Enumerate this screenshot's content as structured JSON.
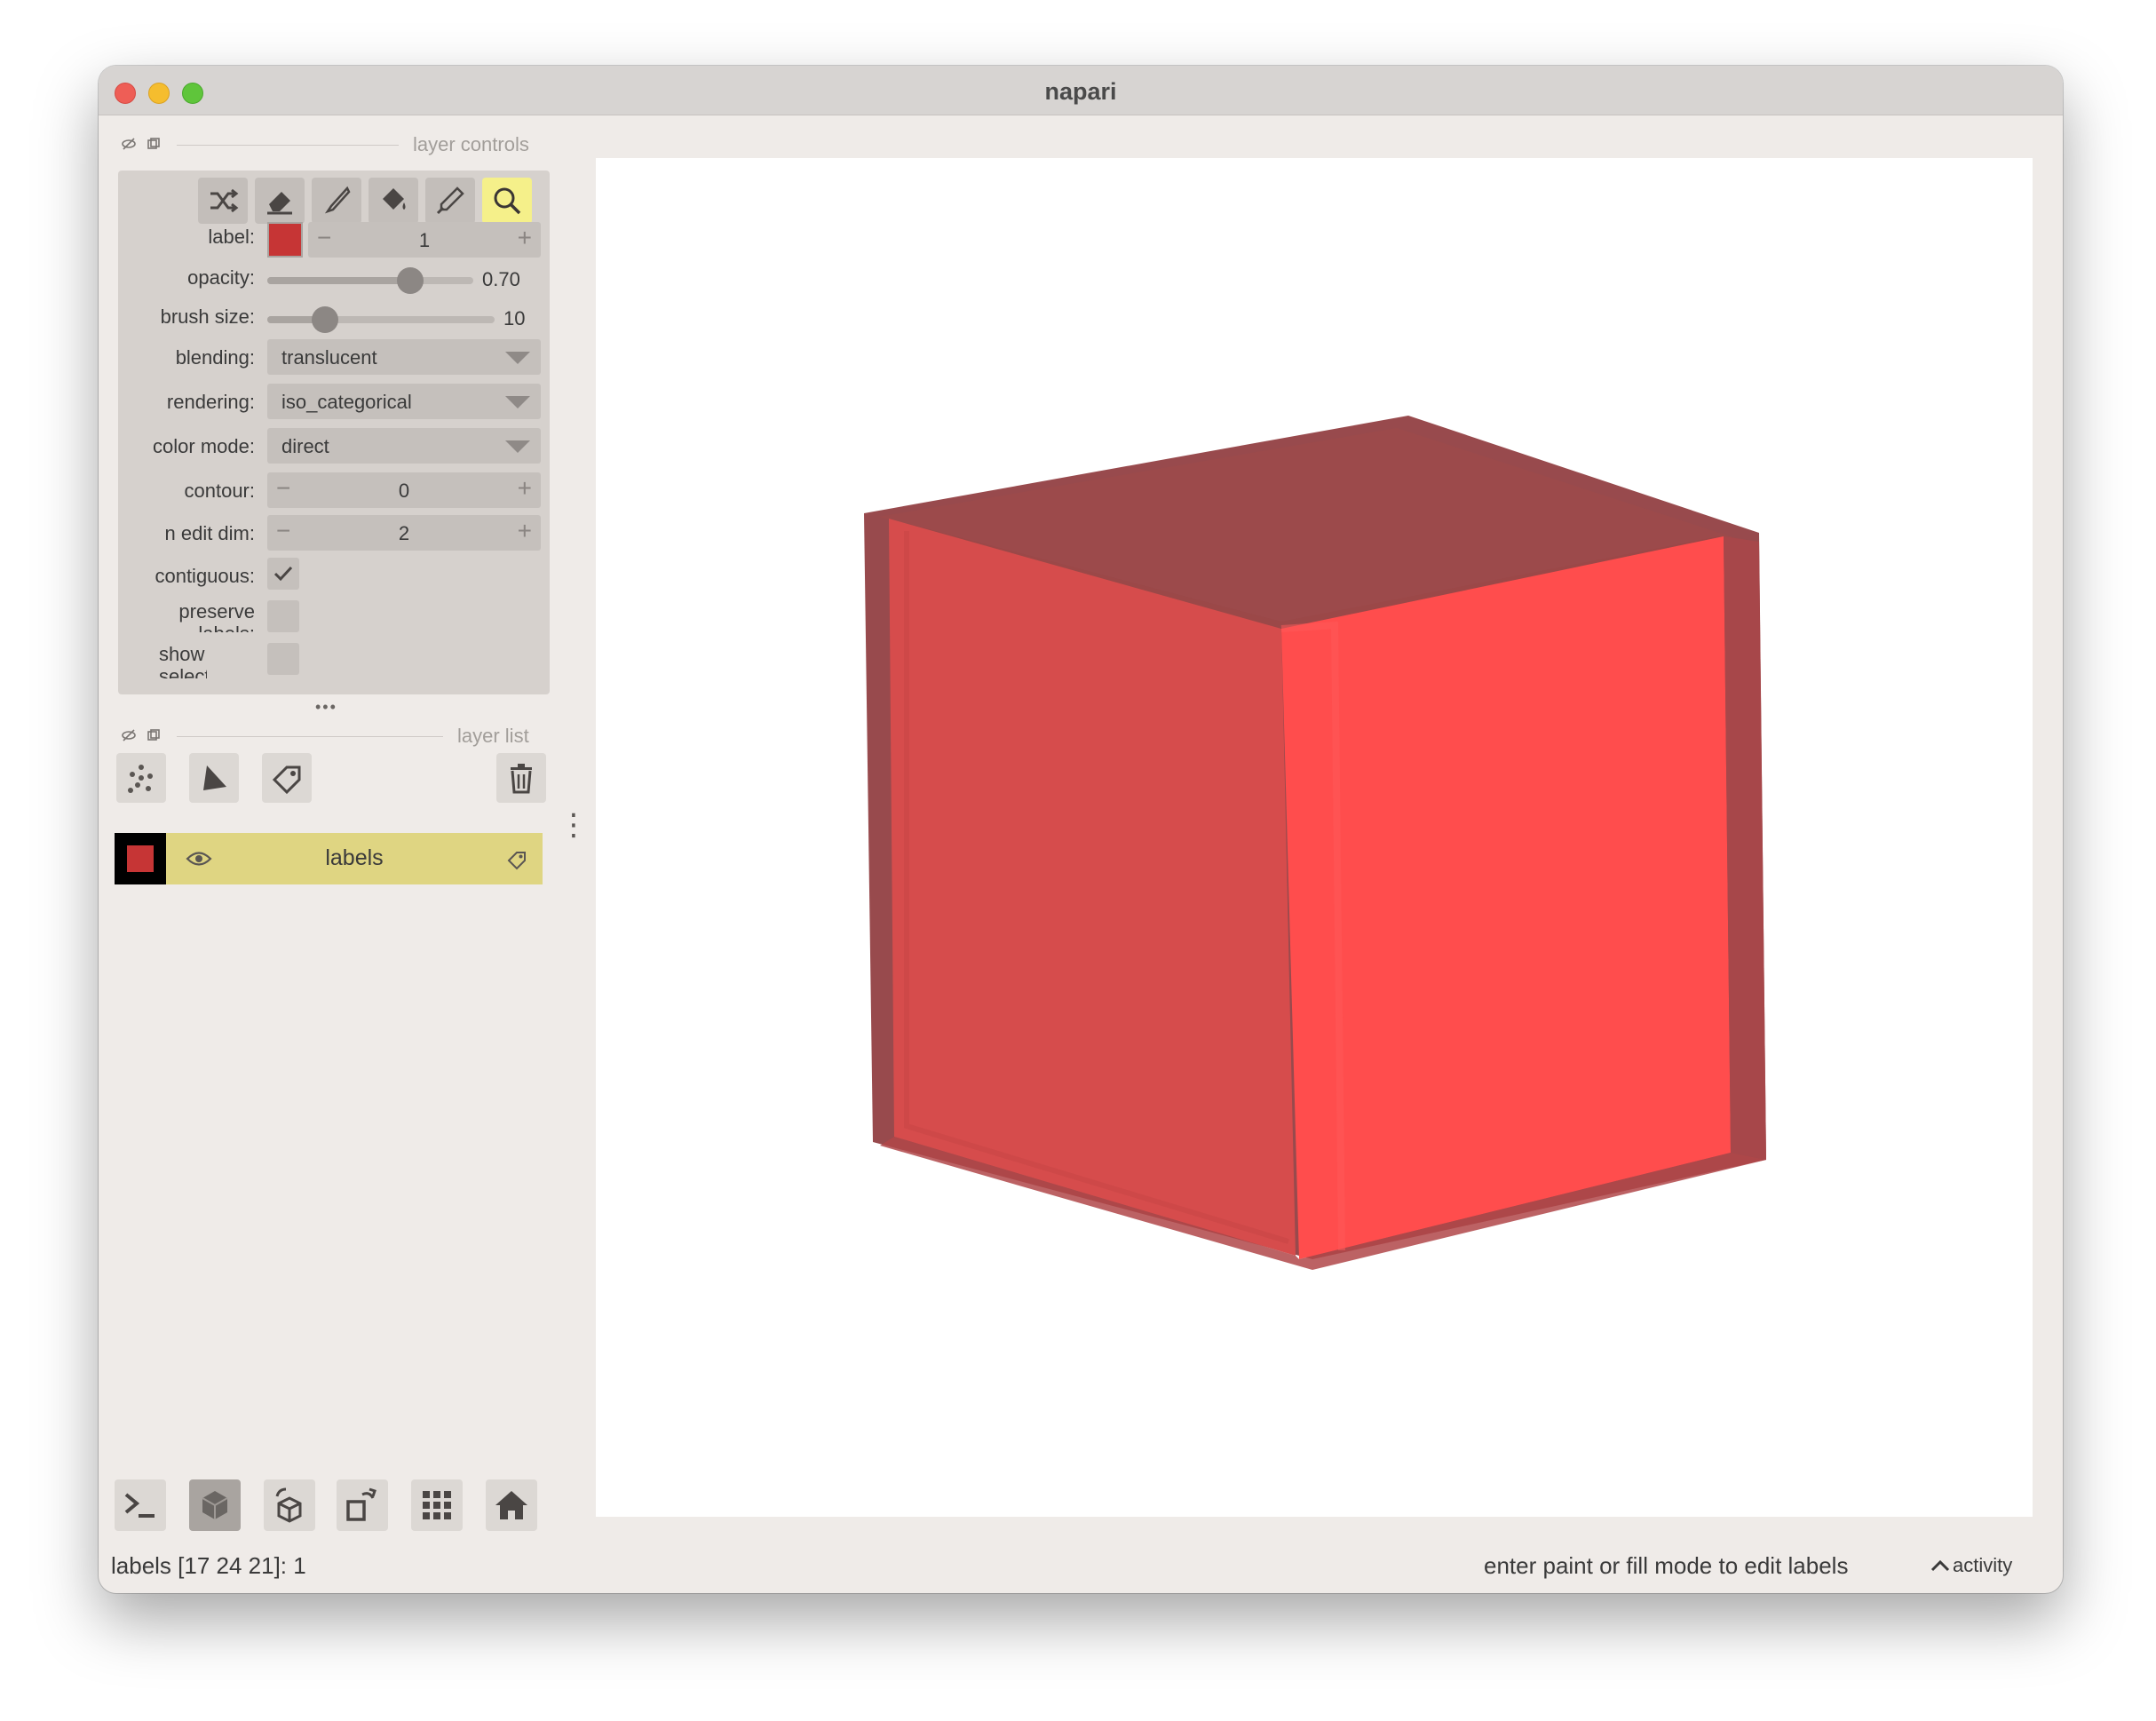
{
  "window": {
    "title": "napari"
  },
  "layer_controls": {
    "title": "layer controls",
    "tools": [
      {
        "name": "shuffle-colors-icon"
      },
      {
        "name": "eraser-icon"
      },
      {
        "name": "paintbrush-icon"
      },
      {
        "name": "fill-bucket-icon"
      },
      {
        "name": "color-picker-icon"
      },
      {
        "name": "pan-zoom-icon",
        "active": true
      }
    ],
    "label": {
      "label": "label:",
      "value": "1",
      "minus": "−",
      "plus": "+",
      "color": "#c63535"
    },
    "opacity": {
      "label": "opacity:",
      "value": "0.70",
      "fraction": 0.7
    },
    "brush_size": {
      "label": "brush size:",
      "value": "10",
      "fraction": 0.27
    },
    "blending": {
      "label": "blending:",
      "value": "translucent"
    },
    "rendering": {
      "label": "rendering:",
      "value": "iso_categorical"
    },
    "color_mode": {
      "label": "color mode:",
      "value": "direct"
    },
    "contour": {
      "label": "contour:",
      "value": "0",
      "minus": "−",
      "plus": "+"
    },
    "n_edit_dim": {
      "label": "n edit dim:",
      "value": "2",
      "minus": "−",
      "plus": "+"
    },
    "contiguous": {
      "label": "contiguous:",
      "checked": true
    },
    "preserve_labels": {
      "label_line1": "preserve",
      "label_line2": "labels:",
      "checked": false
    },
    "show_selected": {
      "label_line1": "show",
      "label_line2": "selected:",
      "checked": false
    },
    "more": "•••"
  },
  "layer_list": {
    "title": "layer list",
    "buttons": [
      "new-points-layer",
      "new-shapes-layer",
      "new-labels-layer",
      "delete-layer"
    ],
    "layers": [
      {
        "name": "labels",
        "visible": true,
        "thumb_color": "#c63535"
      }
    ],
    "menu": "⋮"
  },
  "viewer_buttons": [
    "console",
    "toggle-3d",
    "roll-dimensions",
    "transpose",
    "grid-mode",
    "reset-view"
  ],
  "status_bar": {
    "left": "labels [17 24 21]: 1",
    "right": "enter paint or fill mode to edit labels",
    "activity": "activity",
    "activity_icon": "chevron-up-icon"
  },
  "colors": {
    "accent_yellow": "#dfd582",
    "active_tool": "#f5f08a",
    "cube_front": "#ff4d4d",
    "cube_side": "#d94c4c",
    "cube_top": "#9c4a4b"
  }
}
